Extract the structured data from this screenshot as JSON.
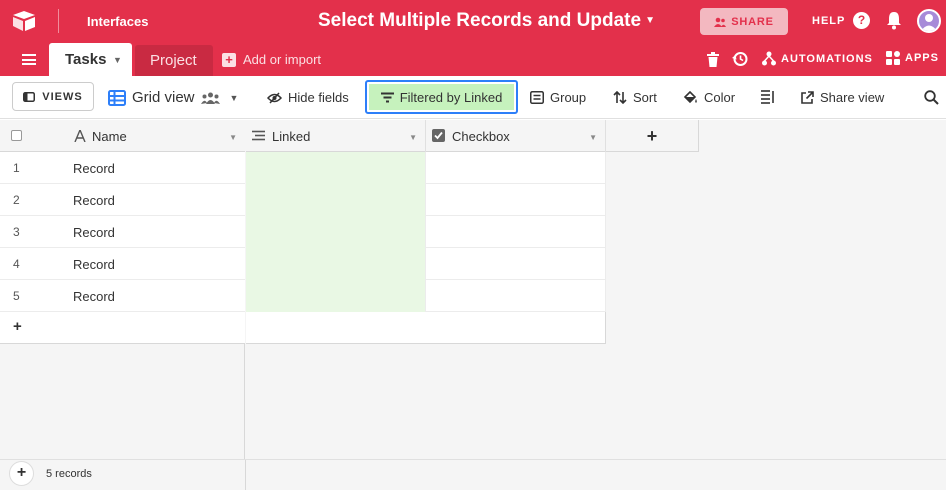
{
  "topbar": {
    "interfaces_label": "Interfaces",
    "base_title": "Select Multiple Records and Update",
    "share_label": "SHARE",
    "help_label": "HELP",
    "help_icon": "?",
    "brand_color": "#e3304b"
  },
  "tabbar": {
    "tabs": [
      {
        "label": "Tasks",
        "active": true
      },
      {
        "label": "Project",
        "active": false
      }
    ],
    "add_import_label": "Add or import",
    "automations_label": "AUTOMATIONS",
    "apps_label": "APPS"
  },
  "toolbar": {
    "views_label": "VIEWS",
    "view_name": "Grid view",
    "hide_fields_label": "Hide fields",
    "filter_label": "Filtered by Linked",
    "group_label": "Group",
    "sort_label": "Sort",
    "color_label": "Color",
    "share_view_label": "Share view",
    "filter_active_color": "#c6f2bd",
    "focus_color": "#2d7ff9"
  },
  "grid": {
    "columns": [
      {
        "label": "Name",
        "icon": "text-icon"
      },
      {
        "label": "Linked",
        "icon": "linked-record-icon"
      },
      {
        "label": "Checkbox",
        "icon": "checkbox-icon"
      }
    ],
    "add_column_label": "+",
    "rows": [
      {
        "num": "1",
        "name": "Record"
      },
      {
        "num": "2",
        "name": "Record"
      },
      {
        "num": "3",
        "name": "Record"
      },
      {
        "num": "4",
        "name": "Record"
      },
      {
        "num": "5",
        "name": "Record"
      }
    ],
    "add_row_label": "+",
    "record_count": "5 records"
  }
}
